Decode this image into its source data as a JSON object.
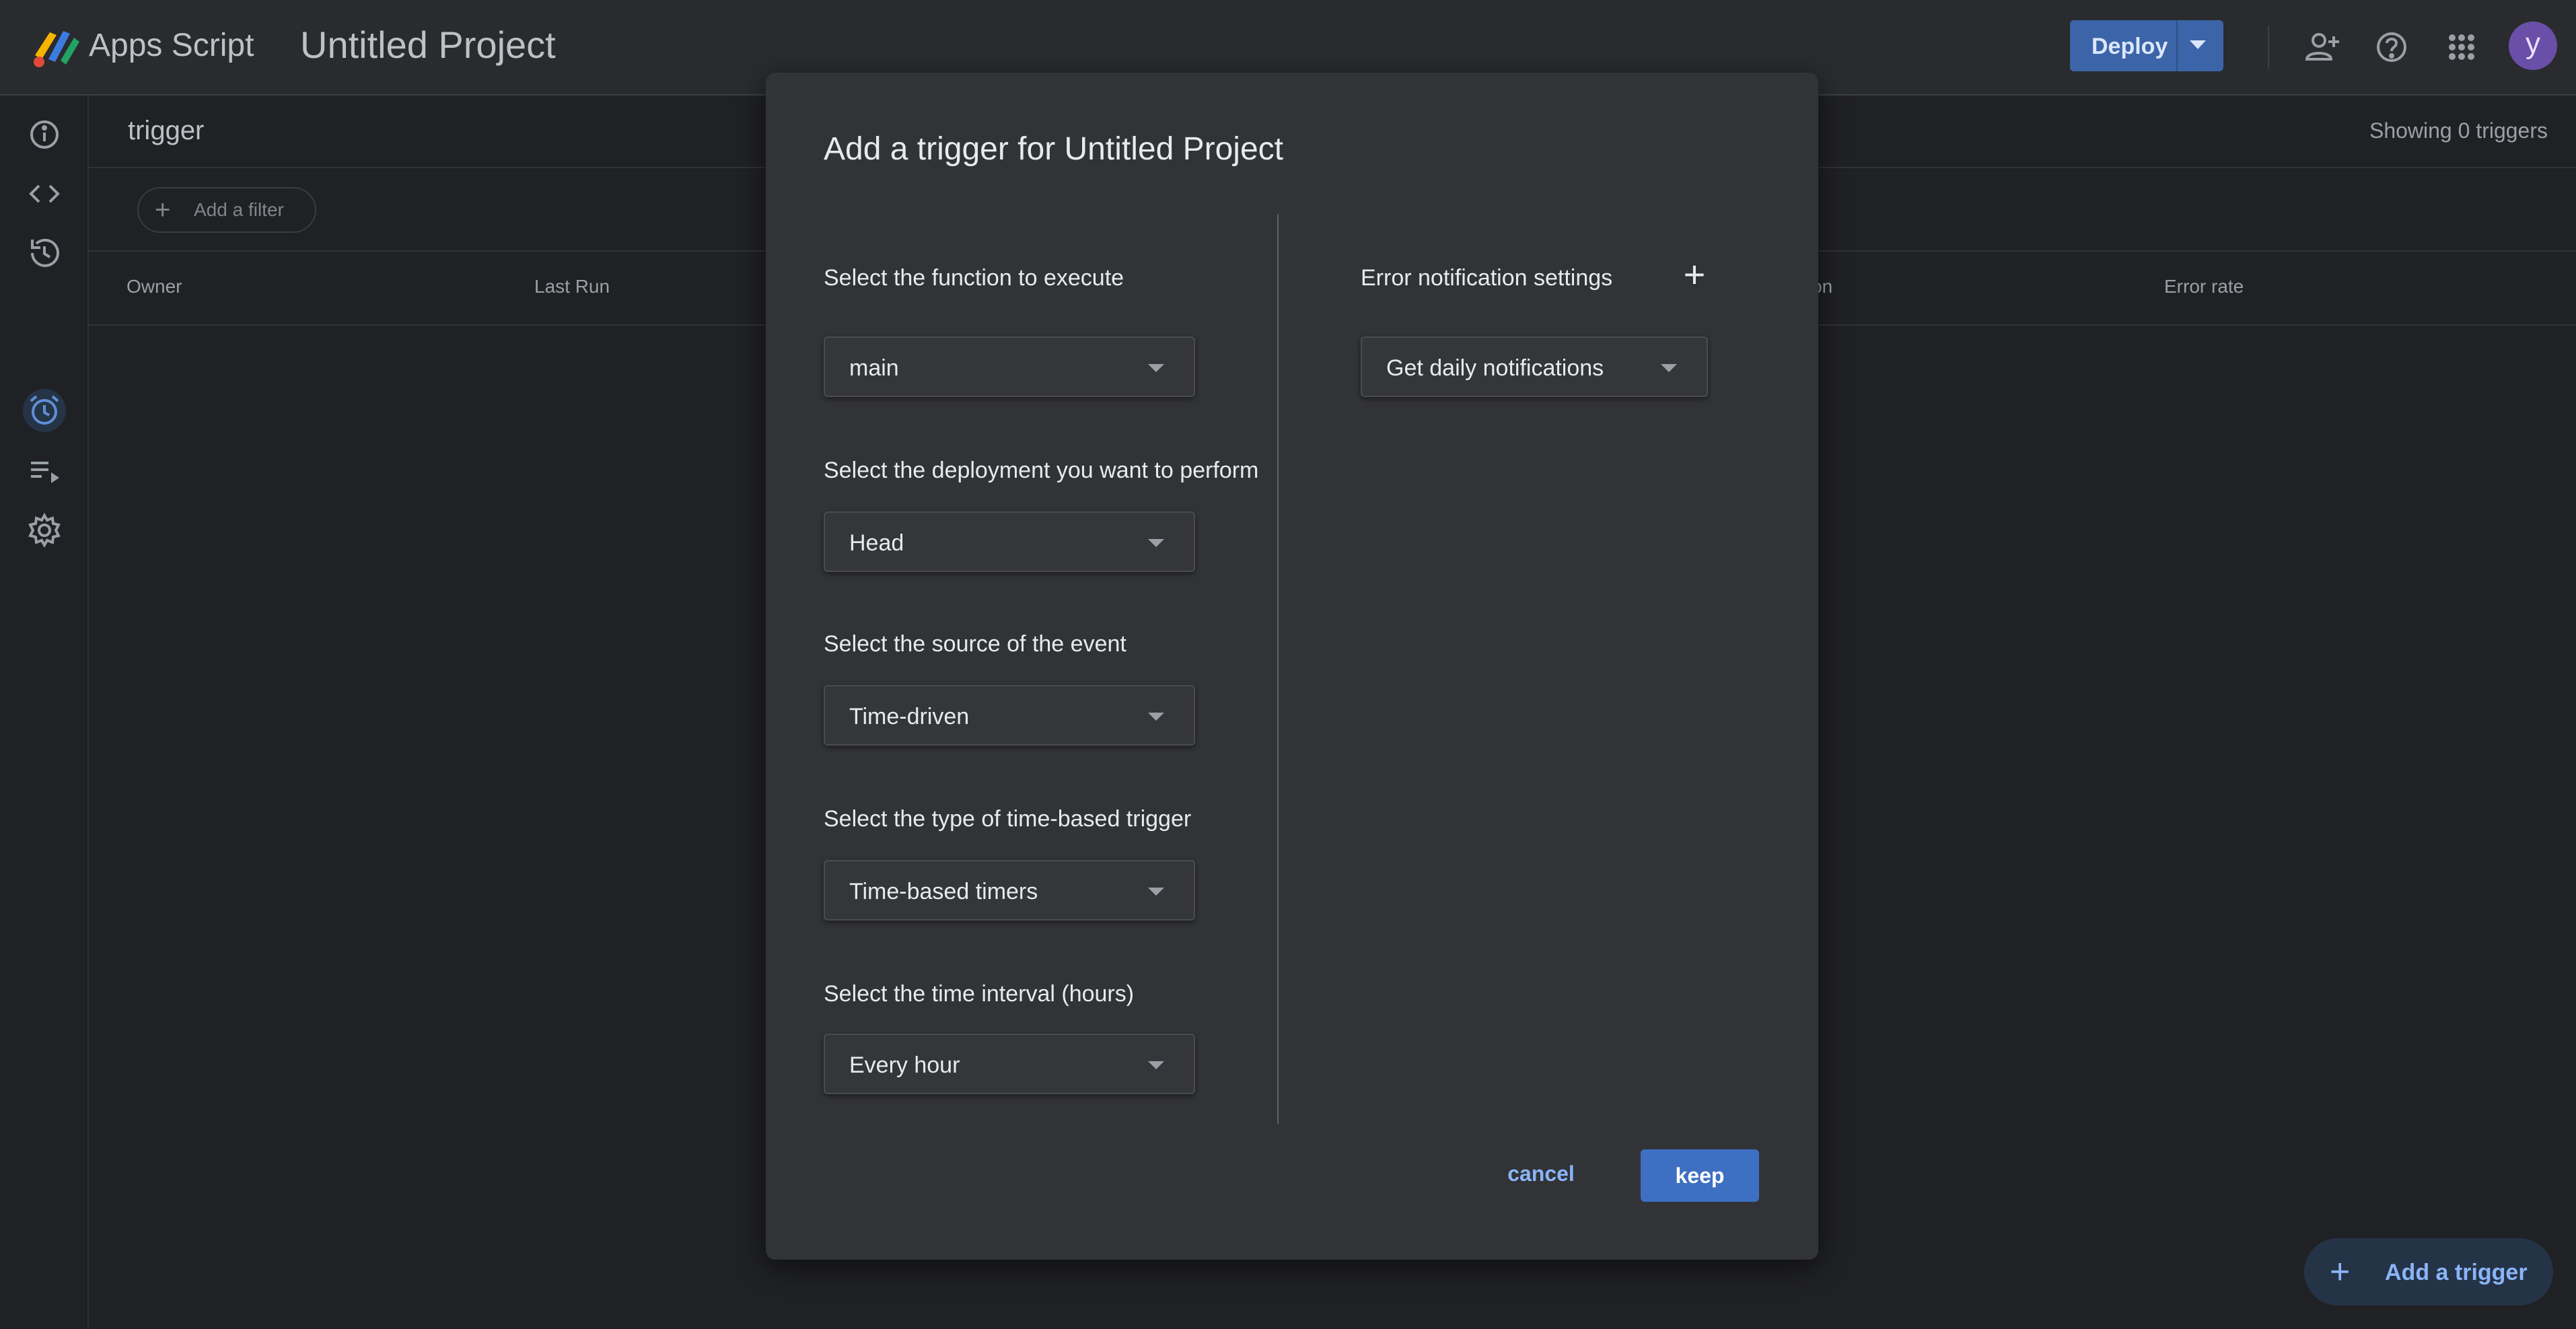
{
  "topbar": {
    "app_name": "Apps Script",
    "project_title": "Untitled Project",
    "deploy_label": "Deploy",
    "avatar_letter": "y"
  },
  "page": {
    "name": "trigger",
    "showing": "Showing 0 triggers",
    "filter_label": "Add a filter",
    "columns": [
      "Owner",
      "Last Run",
      "on",
      "Error rate"
    ]
  },
  "fab": {
    "label": "Add a trigger"
  },
  "dialog": {
    "title": "Add a trigger for Untitled Project",
    "fields": [
      {
        "label": "Select the function to execute",
        "value": "main"
      },
      {
        "label": "Select the deployment you want to perform",
        "value": "Head"
      },
      {
        "label": "Select the source of the event",
        "value": "Time-driven"
      },
      {
        "label": "Select the type of time-based trigger",
        "value": "Time-based timers"
      },
      {
        "label": "Select the time interval (hours)",
        "value": "Every hour"
      }
    ],
    "error_notification": {
      "label": "Error notification settings",
      "value": "Get daily notifications"
    },
    "cancel_label": "cancel",
    "keep_label": "keep"
  },
  "colors": {
    "background": "#202124",
    "dialog": "#323336",
    "primary": "#3d6fc2",
    "link": "#8ab4f8"
  }
}
